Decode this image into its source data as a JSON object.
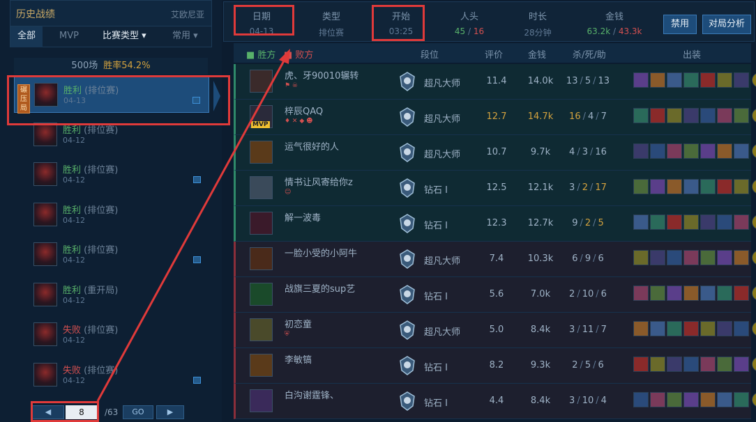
{
  "left": {
    "title": "历史战绩",
    "region": "艾欧尼亚",
    "tabs": [
      "全部",
      "MVP",
      "比赛类型 ▾",
      "常用 ▾"
    ],
    "stats": {
      "matches": "500场",
      "winrate": "胜率54.2%"
    },
    "selected_badge": "碾压局",
    "matches": [
      {
        "result": "胜利",
        "mode": " (排位赛)",
        "date": "04-13",
        "win": true,
        "pic": true
      },
      {
        "result": "胜利",
        "mode": " (排位赛)",
        "date": "04-12",
        "win": true,
        "pic": false
      },
      {
        "result": "胜利",
        "mode": " (排位赛)",
        "date": "04-12",
        "win": true,
        "pic": true
      },
      {
        "result": "胜利",
        "mode": " (排位赛)",
        "date": "04-12",
        "win": true,
        "pic": false
      },
      {
        "result": "胜利",
        "mode": " (排位赛)",
        "date": "04-12",
        "win": true,
        "pic": true
      },
      {
        "result": "胜利",
        "mode": " (重开局)",
        "date": "04-12",
        "win": true,
        "pic": false
      },
      {
        "result": "失败",
        "mode": " (排位赛)",
        "date": "04-12",
        "win": false,
        "pic": false
      },
      {
        "result": "失败",
        "mode": " (排位赛)",
        "date": "04-12",
        "win": false,
        "pic": true
      }
    ],
    "pager": {
      "prev": "◀",
      "page": "8",
      "total": "/63",
      "go": "GO",
      "next": "▶"
    }
  },
  "header": {
    "date_label": "日期",
    "date": "04-13",
    "type_label": "类型",
    "type": "排位赛",
    "start_label": "开始",
    "start": "03:25",
    "kills_label": "人头",
    "kills_win": "45",
    "kills_sep": " / ",
    "kills_lose": "16",
    "dur_label": "时长",
    "dur": "28分钟",
    "gold_label": "金钱",
    "gold_win": "63.2k",
    "gold_sep": " / ",
    "gold_lose": "43.3k",
    "ban_btn": "禁用",
    "analysis_btn": "对局分析"
  },
  "columns": {
    "win": "胜方",
    "lose": "败方",
    "rank": "段位",
    "score": "评价",
    "gold": "金钱",
    "kda": "杀/死/助",
    "items": "出装"
  },
  "players": [
    {
      "name": "虎、牙90010辗转",
      "rank": "超凡大师",
      "score": "11.4",
      "gold": "14.0k",
      "k": "13",
      "d": "5",
      "a": "13",
      "team": "win",
      "tags": "⚑ ☠",
      "mvp": false
    },
    {
      "name": "梓辰QAQ",
      "rank": "超凡大师",
      "score": "12.7",
      "gold": "14.7k",
      "k": "16",
      "d": "4",
      "a": "7",
      "team": "win",
      "tags": "♦ ✕ ◆ ☻",
      "mvp": true,
      "hi": true
    },
    {
      "name": "运气很好的人",
      "rank": "超凡大师",
      "score": "10.7",
      "gold": "9.7k",
      "k": "4",
      "d": "3",
      "a": "16",
      "team": "win",
      "tags": "",
      "mvp": false
    },
    {
      "name": "情书让风寄给你z",
      "rank": "钻石 Ⅰ",
      "score": "12.5",
      "gold": "12.1k",
      "k": "3",
      "d": "2",
      "a": "17",
      "team": "win",
      "tags": "☺",
      "mvp": false,
      "hid": true
    },
    {
      "name": "解一波毒",
      "rank": "钻石 Ⅰ",
      "score": "12.3",
      "gold": "12.7k",
      "k": "9",
      "d": "2",
      "a": "5",
      "team": "win",
      "tags": "",
      "mvp": false,
      "hid": true
    },
    {
      "name": "一脸小受的小阿牛",
      "rank": "超凡大师",
      "score": "7.4",
      "gold": "10.3k",
      "k": "6",
      "d": "9",
      "a": "6",
      "team": "lose",
      "tags": "",
      "mvp": false
    },
    {
      "name": "战旗三夏的sup艺",
      "rank": "钻石 Ⅰ",
      "score": "5.6",
      "gold": "7.0k",
      "k": "2",
      "d": "10",
      "a": "6",
      "team": "lose",
      "tags": "",
      "mvp": false
    },
    {
      "name": "初恋童",
      "rank": "超凡大师",
      "score": "5.0",
      "gold": "8.4k",
      "k": "3",
      "d": "11",
      "a": "7",
      "team": "lose",
      "tags": "⛨",
      "mvp": false
    },
    {
      "name": "李敏镐",
      "rank": "钻石 Ⅰ",
      "score": "8.2",
      "gold": "9.3k",
      "k": "2",
      "d": "5",
      "a": "6",
      "team": "lose",
      "tags": "",
      "mvp": false
    },
    {
      "name": "白沟谢霆锋、",
      "rank": "钻石 Ⅰ",
      "score": "4.4",
      "gold": "8.4k",
      "k": "3",
      "d": "10",
      "a": "4",
      "team": "lose",
      "tags": "",
      "mvp": false
    }
  ],
  "mvp_label": "MVP",
  "colors": {
    "accent": "#e03a3a",
    "win": "#58b16a",
    "lose": "#d45050",
    "gold": "#d3a23e"
  }
}
